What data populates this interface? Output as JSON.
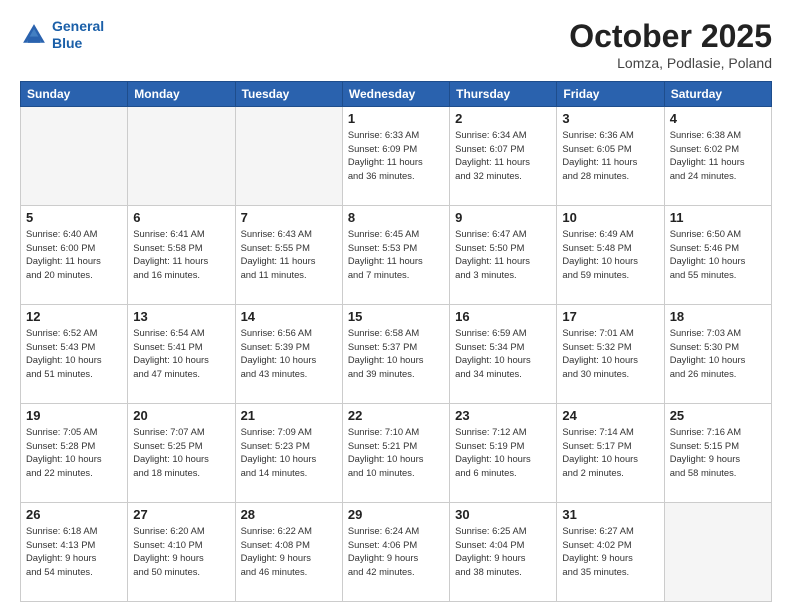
{
  "header": {
    "logo_line1": "General",
    "logo_line2": "Blue",
    "title": "October 2025",
    "subtitle": "Lomza, Podlasie, Poland"
  },
  "days_of_week": [
    "Sunday",
    "Monday",
    "Tuesday",
    "Wednesday",
    "Thursday",
    "Friday",
    "Saturday"
  ],
  "weeks": [
    [
      {
        "day": "",
        "info": ""
      },
      {
        "day": "",
        "info": ""
      },
      {
        "day": "",
        "info": ""
      },
      {
        "day": "1",
        "info": "Sunrise: 6:33 AM\nSunset: 6:09 PM\nDaylight: 11 hours\nand 36 minutes."
      },
      {
        "day": "2",
        "info": "Sunrise: 6:34 AM\nSunset: 6:07 PM\nDaylight: 11 hours\nand 32 minutes."
      },
      {
        "day": "3",
        "info": "Sunrise: 6:36 AM\nSunset: 6:05 PM\nDaylight: 11 hours\nand 28 minutes."
      },
      {
        "day": "4",
        "info": "Sunrise: 6:38 AM\nSunset: 6:02 PM\nDaylight: 11 hours\nand 24 minutes."
      }
    ],
    [
      {
        "day": "5",
        "info": "Sunrise: 6:40 AM\nSunset: 6:00 PM\nDaylight: 11 hours\nand 20 minutes."
      },
      {
        "day": "6",
        "info": "Sunrise: 6:41 AM\nSunset: 5:58 PM\nDaylight: 11 hours\nand 16 minutes."
      },
      {
        "day": "7",
        "info": "Sunrise: 6:43 AM\nSunset: 5:55 PM\nDaylight: 11 hours\nand 11 minutes."
      },
      {
        "day": "8",
        "info": "Sunrise: 6:45 AM\nSunset: 5:53 PM\nDaylight: 11 hours\nand 7 minutes."
      },
      {
        "day": "9",
        "info": "Sunrise: 6:47 AM\nSunset: 5:50 PM\nDaylight: 11 hours\nand 3 minutes."
      },
      {
        "day": "10",
        "info": "Sunrise: 6:49 AM\nSunset: 5:48 PM\nDaylight: 10 hours\nand 59 minutes."
      },
      {
        "day": "11",
        "info": "Sunrise: 6:50 AM\nSunset: 5:46 PM\nDaylight: 10 hours\nand 55 minutes."
      }
    ],
    [
      {
        "day": "12",
        "info": "Sunrise: 6:52 AM\nSunset: 5:43 PM\nDaylight: 10 hours\nand 51 minutes."
      },
      {
        "day": "13",
        "info": "Sunrise: 6:54 AM\nSunset: 5:41 PM\nDaylight: 10 hours\nand 47 minutes."
      },
      {
        "day": "14",
        "info": "Sunrise: 6:56 AM\nSunset: 5:39 PM\nDaylight: 10 hours\nand 43 minutes."
      },
      {
        "day": "15",
        "info": "Sunrise: 6:58 AM\nSunset: 5:37 PM\nDaylight: 10 hours\nand 39 minutes."
      },
      {
        "day": "16",
        "info": "Sunrise: 6:59 AM\nSunset: 5:34 PM\nDaylight: 10 hours\nand 34 minutes."
      },
      {
        "day": "17",
        "info": "Sunrise: 7:01 AM\nSunset: 5:32 PM\nDaylight: 10 hours\nand 30 minutes."
      },
      {
        "day": "18",
        "info": "Sunrise: 7:03 AM\nSunset: 5:30 PM\nDaylight: 10 hours\nand 26 minutes."
      }
    ],
    [
      {
        "day": "19",
        "info": "Sunrise: 7:05 AM\nSunset: 5:28 PM\nDaylight: 10 hours\nand 22 minutes."
      },
      {
        "day": "20",
        "info": "Sunrise: 7:07 AM\nSunset: 5:25 PM\nDaylight: 10 hours\nand 18 minutes."
      },
      {
        "day": "21",
        "info": "Sunrise: 7:09 AM\nSunset: 5:23 PM\nDaylight: 10 hours\nand 14 minutes."
      },
      {
        "day": "22",
        "info": "Sunrise: 7:10 AM\nSunset: 5:21 PM\nDaylight: 10 hours\nand 10 minutes."
      },
      {
        "day": "23",
        "info": "Sunrise: 7:12 AM\nSunset: 5:19 PM\nDaylight: 10 hours\nand 6 minutes."
      },
      {
        "day": "24",
        "info": "Sunrise: 7:14 AM\nSunset: 5:17 PM\nDaylight: 10 hours\nand 2 minutes."
      },
      {
        "day": "25",
        "info": "Sunrise: 7:16 AM\nSunset: 5:15 PM\nDaylight: 9 hours\nand 58 minutes."
      }
    ],
    [
      {
        "day": "26",
        "info": "Sunrise: 6:18 AM\nSunset: 4:13 PM\nDaylight: 9 hours\nand 54 minutes."
      },
      {
        "day": "27",
        "info": "Sunrise: 6:20 AM\nSunset: 4:10 PM\nDaylight: 9 hours\nand 50 minutes."
      },
      {
        "day": "28",
        "info": "Sunrise: 6:22 AM\nSunset: 4:08 PM\nDaylight: 9 hours\nand 46 minutes."
      },
      {
        "day": "29",
        "info": "Sunrise: 6:24 AM\nSunset: 4:06 PM\nDaylight: 9 hours\nand 42 minutes."
      },
      {
        "day": "30",
        "info": "Sunrise: 6:25 AM\nSunset: 4:04 PM\nDaylight: 9 hours\nand 38 minutes."
      },
      {
        "day": "31",
        "info": "Sunrise: 6:27 AM\nSunset: 4:02 PM\nDaylight: 9 hours\nand 35 minutes."
      },
      {
        "day": "",
        "info": ""
      }
    ]
  ]
}
